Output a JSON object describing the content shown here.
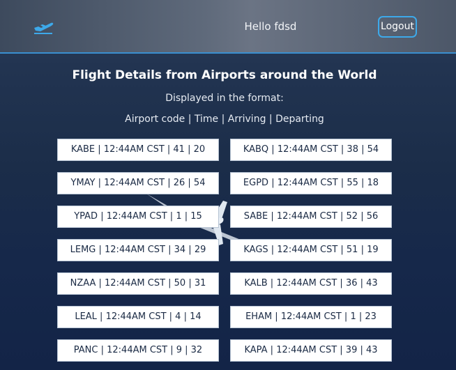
{
  "header": {
    "logo_icon": "airplane-departure-icon",
    "greeting": "Hello fdsd",
    "logout_label": "Logout"
  },
  "intro": {
    "title": "Flight Details from Airports around the World",
    "subtitle": "Displayed in the format:",
    "format": "Airport code | Time | Arriving | Departing"
  },
  "flights": [
    "KABE | 12:44AM CST | 41 | 20",
    "KABQ | 12:44AM CST | 38 | 54",
    "YMAY | 12:44AM CST | 26 | 54",
    "EGPD | 12:44AM CST | 55 | 18",
    "YPAD | 12:44AM CST | 1 | 15",
    "SABE | 12:44AM CST | 52 | 56",
    "LEMG | 12:44AM CST | 34 | 29",
    "KAGS | 12:44AM CST | 51 | 19",
    "NZAA | 12:44AM CST | 50 | 31",
    "KALB | 12:44AM CST | 36 | 43",
    "LEAL | 12:44AM CST | 4 | 14",
    "EHAM | 12:44AM CST | 1 | 23",
    "PANC | 12:44AM CST | 9 | 32",
    "KAPA | 12:44AM CST | 39 | 43"
  ],
  "colors": {
    "accent": "#3da9ea",
    "card_bg": "#ffffff",
    "card_text": "#1a2a44"
  }
}
